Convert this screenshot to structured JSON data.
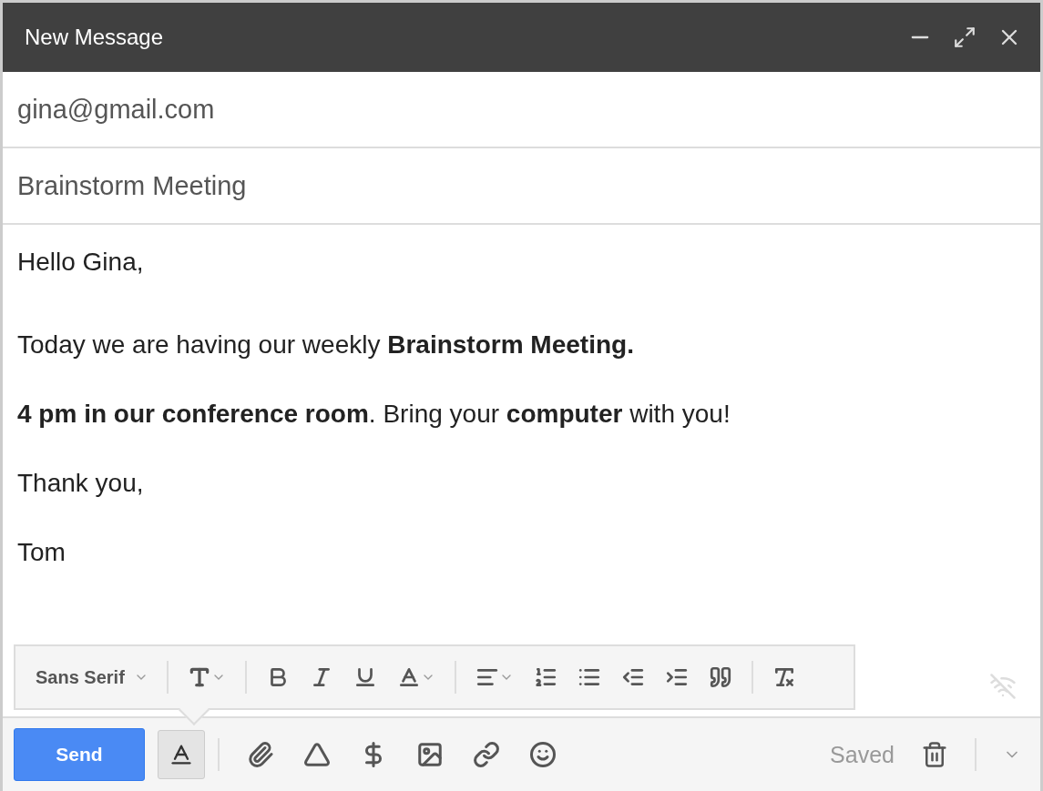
{
  "window": {
    "title": "New Message"
  },
  "recipient": "gina@gmail.com",
  "subject": "Brainstorm Meeting",
  "body": [
    "Hello Gina,",
    "Today we are having our weekly **Brainstorm Meeting.**",
    "**4 pm in our conference room**. Bring your **computer** with you!",
    "Thank you,",
    "Tom"
  ],
  "format_toolbar": {
    "font": "Sans Serif"
  },
  "bottom_bar": {
    "send": "Send",
    "formatting_selected": true,
    "status": "Saved"
  }
}
